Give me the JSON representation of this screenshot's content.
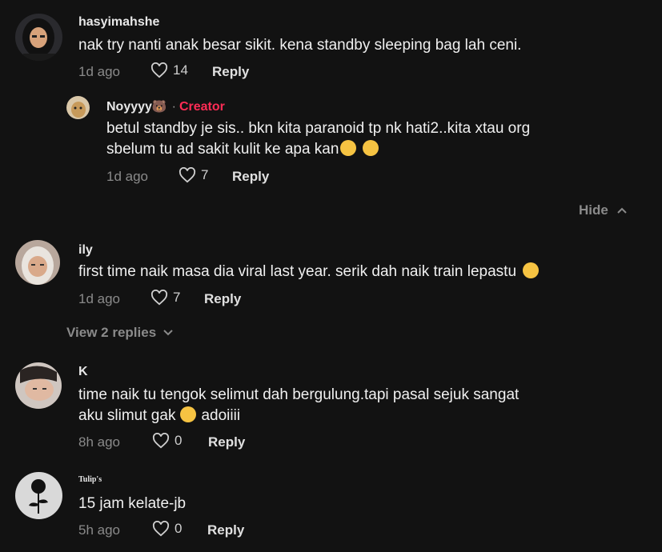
{
  "comments": [
    {
      "username": "hasyimahshe",
      "text": "nak try nanti anak besar sikit. kena standby sleeping bag lah ceni.",
      "time": "1d ago",
      "likes": "14",
      "reply_label": "Reply",
      "reply": {
        "username": "Noyyyy",
        "username_emoji": "🐻",
        "creator_label": "Creator",
        "text_line1": "betul standby je sis.. bkn kita paranoid tp nk hati2..kita xtau org",
        "text_line2": "sbelum tu ad sakit kulit ke apa kan",
        "time": "1d ago",
        "likes": "7",
        "reply_label": "Reply"
      },
      "hide_label": "Hide"
    },
    {
      "username": "ily",
      "text": "first time naik masa dia viral last year. serik dah naik train lepastu",
      "time": "1d ago",
      "likes": "7",
      "reply_label": "Reply",
      "view_replies_label": "View 2 replies"
    },
    {
      "username": "K",
      "text_line1": "time naik tu tengok selimut dah bergulung.tapi pasal sejuk sangat",
      "text_line2a": "aku slimut gak",
      "text_line2b": "adoiiii",
      "time": "8h ago",
      "likes": "0",
      "reply_label": "Reply"
    },
    {
      "username": "Tulip's",
      "text": "15 jam kelate-jb",
      "time": "5h ago",
      "likes": "0",
      "reply_label": "Reply"
    }
  ],
  "colors": {
    "background": "#121212",
    "creator": "#fe2c55",
    "muted": "#8a8a8a"
  },
  "icons": [
    "heart-outline-icon",
    "chevron-up-icon",
    "chevron-down-icon",
    "flushed-face-emoji",
    "rolling-laughing-emoji"
  ]
}
